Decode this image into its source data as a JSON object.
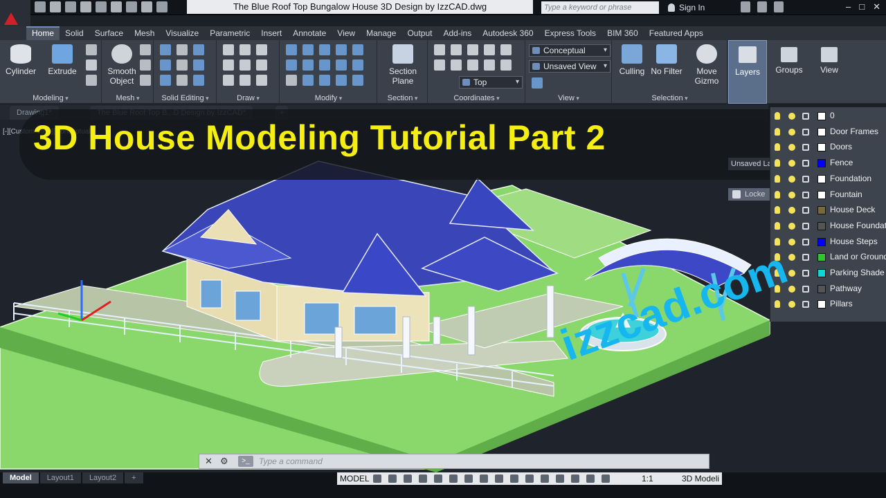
{
  "window": {
    "title": "The Blue Roof Top Bungalow House 3D Design by IzzCAD.dwg",
    "search_placeholder": "Type a keyword or phrase",
    "signin": "Sign In"
  },
  "ribbon": {
    "tabs": [
      "Home",
      "Solid",
      "Surface",
      "Mesh",
      "Visualize",
      "Parametric",
      "Insert",
      "Annotate",
      "View",
      "Manage",
      "Output",
      "Add-ins",
      "Autodesk 360",
      "Express Tools",
      "BIM 360",
      "Featured Apps"
    ],
    "active_tab": "Home",
    "groups": {
      "modeling": "Modeling",
      "mesh": "Mesh",
      "solid_editing": "Solid Editing",
      "draw": "Draw",
      "modify": "Modify",
      "section": "Section",
      "coordinates": "Coordinates",
      "view": "View",
      "selection": "Selection"
    },
    "buttons": {
      "cylinder": "Cylinder",
      "extrude": "Extrude",
      "smooth_object_1": "Smooth",
      "smooth_object_2": "Object",
      "section_plane_1": "Section",
      "section_plane_2": "Plane",
      "culling": "Culling",
      "no_filter": "No Filter",
      "move_gizmo_1": "Move",
      "move_gizmo_2": "Gizmo",
      "layers": "Layers",
      "groups": "Groups",
      "view": "View"
    },
    "visual_style": "Conceptual",
    "view_state": "Unsaved View",
    "ucs": "Top"
  },
  "file_tabs": [
    "Drawing1*",
    "The Blue Roof Top B...D Design by IzzCAD*"
  ],
  "viewport_label": "[-][Custom View][Conceptual]",
  "banner": "3D House Modeling Tutorial Part 2",
  "watermark": "izzcad.com",
  "layer_controls": {
    "unsaved": "Unsaved La",
    "locked": "Locke"
  },
  "layers": [
    {
      "name": "0",
      "color": "#ffffff"
    },
    {
      "name": "Door Frames",
      "color": "#ffffff"
    },
    {
      "name": "Doors",
      "color": "#ffffff"
    },
    {
      "name": "Fence",
      "color": "#0000ff"
    },
    {
      "name": "Foundation",
      "color": "#ffffff"
    },
    {
      "name": "Fountain",
      "color": "#ffffff"
    },
    {
      "name": "House Deck",
      "color": "#7a6a3a"
    },
    {
      "name": "House Foundation",
      "color": "#555555"
    },
    {
      "name": "House Steps",
      "color": "#0000ff"
    },
    {
      "name": "Land or Ground",
      "color": "#2ec62e"
    },
    {
      "name": "Parking Shade",
      "color": "#11d6d6"
    },
    {
      "name": "Pathway",
      "color": "#555555"
    },
    {
      "name": "Pillars",
      "color": "#ffffff"
    }
  ],
  "command_line": {
    "placeholder": "Type a command"
  },
  "status": {
    "layout_tabs": [
      "Model",
      "Layout1",
      "Layout2",
      "+"
    ],
    "model": "MODEL",
    "scale": "1:1",
    "workspace": "3D Modeli"
  }
}
